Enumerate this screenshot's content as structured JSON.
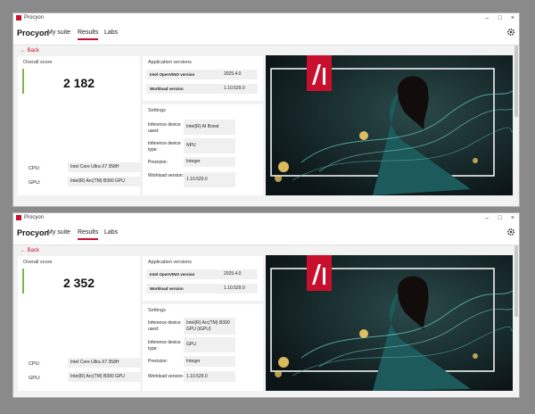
{
  "app_title": "Procyon",
  "brand": "Procyon",
  "nav": [
    "My suite",
    "Results",
    "Labs"
  ],
  "back": "Back",
  "controls": {
    "minimize": "–",
    "maximize": "□",
    "close": "×"
  },
  "overall_label": "Overall score",
  "spec_labels": {
    "cpu": "CPU:",
    "gpu": "GPU:"
  },
  "versions_title": "Application versions",
  "settings_title": "Settings",
  "hero_badge": "AI",
  "windows": [
    {
      "score": "2 182",
      "cpu": "Intel Core Ultra X7 358H",
      "gpu": "Intel(R) Arc(TM) B390 GPU",
      "versions": [
        {
          "label": "Intel OpenVINO version",
          "value": "2025.4.0"
        },
        {
          "label": "Workload version",
          "value": "1.10.529.0"
        }
      ],
      "settings": [
        {
          "label": "Inference device used:",
          "value": "Intel(R) AI Boost"
        },
        {
          "label": "Inference device type:",
          "value": "NPU"
        },
        {
          "label": "Precision:",
          "value": "Integer"
        },
        {
          "label": "Workload version:",
          "value": "1.10.529.0"
        }
      ]
    },
    {
      "score": "2 352",
      "cpu": "Intel Core Ultra X7 358H",
      "gpu": "Intel(R) Arc(TM) B390 GPU",
      "versions": [
        {
          "label": "Intel OpenVINO version",
          "value": "2025.4.0"
        },
        {
          "label": "Workload version",
          "value": "1.10.529.0"
        }
      ],
      "settings": [
        {
          "label": "Inference device used:",
          "value": "Intel(R) Arc(TM) B390 GPU (iGPU)"
        },
        {
          "label": "Inference device type:",
          "value": "GPU"
        },
        {
          "label": "Precision:",
          "value": "Integer"
        },
        {
          "label": "Workload version:",
          "value": "1.10.529.0"
        }
      ]
    }
  ]
}
